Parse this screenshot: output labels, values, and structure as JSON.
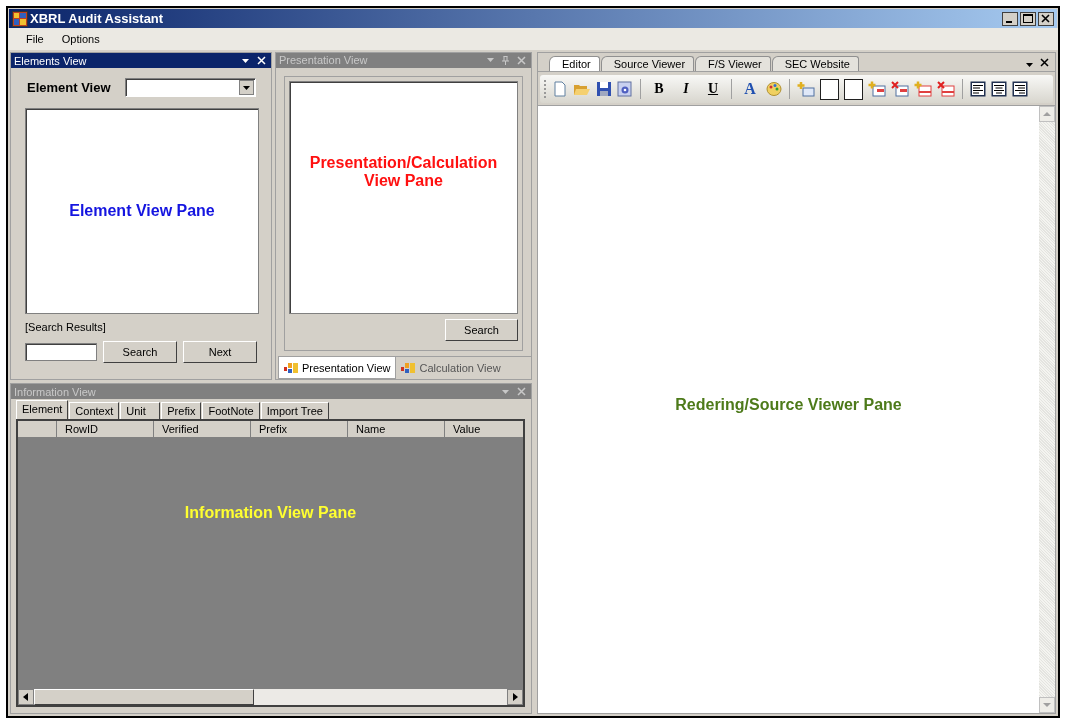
{
  "window": {
    "title": "XBRL Audit Assistant"
  },
  "menu": [
    "File",
    "Options"
  ],
  "elements_view": {
    "title": "Elements View",
    "active": true,
    "combo_label": "Element View",
    "pane_label": "Element View Pane",
    "search_results": "[Search Results]",
    "buttons": [
      "Search",
      "Next"
    ]
  },
  "presentation_view": {
    "title": "Presentation View",
    "active": false,
    "pane_label": "Presentation/Calculation View Pane",
    "search_button": "Search",
    "tabs": [
      {
        "label": "Presentation View",
        "selected": true
      },
      {
        "label": "Calculation View",
        "selected": false
      }
    ]
  },
  "information_view": {
    "title": "Information View",
    "active": false,
    "tabs": [
      {
        "label": "Element",
        "selected": true
      },
      {
        "label": "Context",
        "selected": false
      },
      {
        "label": "Unit",
        "selected": false
      },
      {
        "label": "Prefix",
        "selected": false
      },
      {
        "label": "FootNote",
        "selected": false
      },
      {
        "label": "Import Tree",
        "selected": false
      }
    ],
    "columns": [
      "RowID",
      "Verified",
      "Prefix",
      "Name",
      "Value"
    ],
    "pane_label": "Information View Pane"
  },
  "viewer": {
    "tabs": [
      {
        "label": "Editor",
        "selected": true
      },
      {
        "label": "Source Viewer",
        "selected": false
      },
      {
        "label": "F/S Viewer",
        "selected": false
      },
      {
        "label": "SEC Website",
        "selected": false
      }
    ],
    "toolbar_text_groups": [
      [
        {
          "label": "B",
          "kind": "bold"
        },
        {
          "label": "I",
          "kind": "italic"
        },
        {
          "label": "U",
          "kind": "underline"
        }
      ],
      [
        {
          "label": "A",
          "kind": "color"
        }
      ]
    ],
    "pane_label": "Redering/Source Viewer Pane"
  }
}
